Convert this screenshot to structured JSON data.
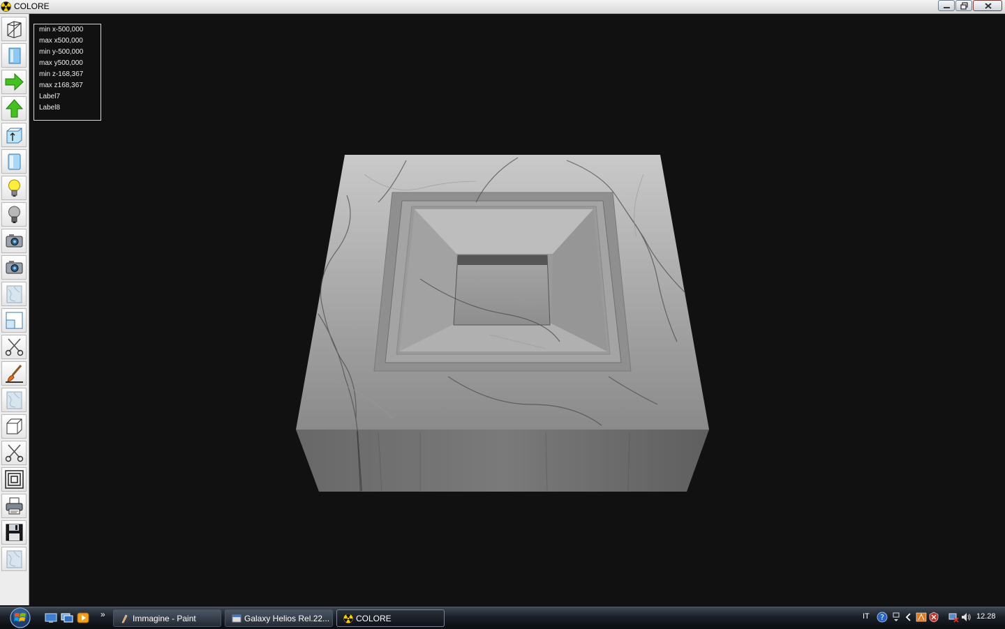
{
  "window": {
    "title": "COLORE",
    "buttons": {
      "minimize": "minimize",
      "restore": "restore",
      "close": "close"
    }
  },
  "toolbar": {
    "items": [
      {
        "name": "wireframe-box-tool",
        "icon": "wireframe-cube-icon"
      },
      {
        "name": "blue-panel-tool",
        "icon": "blue-panel-icon"
      },
      {
        "name": "arrow-right-tool",
        "icon": "green-arrow-right-icon"
      },
      {
        "name": "arrow-up-tool",
        "icon": "green-arrow-up-icon"
      },
      {
        "name": "extrude-up-tool",
        "icon": "box-arrow-up-icon"
      },
      {
        "name": "cylinder-tool",
        "icon": "blue-cylinder-icon"
      },
      {
        "name": "light-on-tool",
        "icon": "lightbulb-on-icon"
      },
      {
        "name": "light-off-tool",
        "icon": "lightbulb-off-icon"
      },
      {
        "name": "camera-tool-1",
        "icon": "camera-icon"
      },
      {
        "name": "camera-tool-2",
        "icon": "camera-icon"
      },
      {
        "name": "texture-tool-1",
        "icon": "marble-texture-icon"
      },
      {
        "name": "window-tool",
        "icon": "window-frame-icon"
      },
      {
        "name": "cut-tool-1",
        "icon": "scissors-icon"
      },
      {
        "name": "paint-tool",
        "icon": "paintbrush-icon"
      },
      {
        "name": "texture-tool-2",
        "icon": "marble-texture-icon"
      },
      {
        "name": "cube-tool",
        "icon": "white-cube-icon"
      },
      {
        "name": "cut-tool-2",
        "icon": "scissors-icon"
      },
      {
        "name": "nested-squares-tool",
        "icon": "nested-squares-icon"
      },
      {
        "name": "print-tool",
        "icon": "printer-icon"
      },
      {
        "name": "save-tool",
        "icon": "floppy-disk-icon"
      },
      {
        "name": "texture-tool-3",
        "icon": "marble-texture-icon"
      }
    ]
  },
  "info": {
    "lines": [
      "min x-500,000",
      "max x500,000",
      "min y-500,000",
      "max y500,000",
      "min z-168,367",
      "max z168,367",
      "Label7",
      "Label8"
    ]
  },
  "taskbar": {
    "tasks": [
      {
        "label": "Immagine - Paint",
        "icon": "paint-icon"
      },
      {
        "label": "Galaxy Helios  Rel.22...",
        "icon": "application-icon"
      },
      {
        "label": "COLORE",
        "icon": "colore-radiation-icon"
      }
    ],
    "quick_launch": [
      "show-desktop-icon",
      "switch-windows-icon",
      "media-player-icon"
    ],
    "overflow": "»",
    "tray": {
      "language": "IT",
      "time": "12.28"
    }
  },
  "colors": {
    "viewport": "#111111",
    "marble": "#d8d8d8",
    "taskbar": "#1b2028"
  }
}
